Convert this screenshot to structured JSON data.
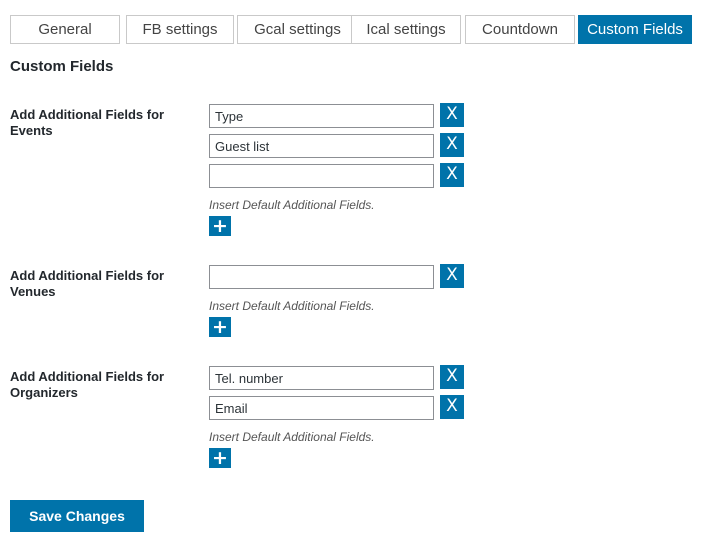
{
  "tabs": [
    {
      "label": "General",
      "active": false
    },
    {
      "label": "FB settings",
      "active": false
    },
    {
      "label": "Gcal settings",
      "active": false
    },
    {
      "label": "Ical settings",
      "active": false
    },
    {
      "label": "Countdown",
      "active": false
    },
    {
      "label": "Custom Fields",
      "active": true
    }
  ],
  "page_title": "Custom Fields",
  "sections": [
    {
      "label_line1": "Add Additional Fields for",
      "label_line2": "Events",
      "fields": [
        "Type",
        "Guest list",
        ""
      ],
      "remove_label": "X",
      "hint": "Insert Default Additional Fields.",
      "add_label": "+"
    },
    {
      "label_line1": "Add Additional Fields for",
      "label_line2": "Venues",
      "fields": [
        ""
      ],
      "remove_label": "X",
      "hint": "Insert Default Additional Fields.",
      "add_label": "+"
    },
    {
      "label_line1": "Add Additional Fields for",
      "label_line2": "Organizers",
      "fields": [
        "Tel. number",
        "Email"
      ],
      "remove_label": "X",
      "hint": "Insert Default Additional Fields.",
      "add_label": "+"
    }
  ],
  "save_label": "Save Changes",
  "colors": {
    "accent": "#0073aa",
    "tab_border": "#c9c9c9",
    "input_border": "#8c8f94"
  }
}
